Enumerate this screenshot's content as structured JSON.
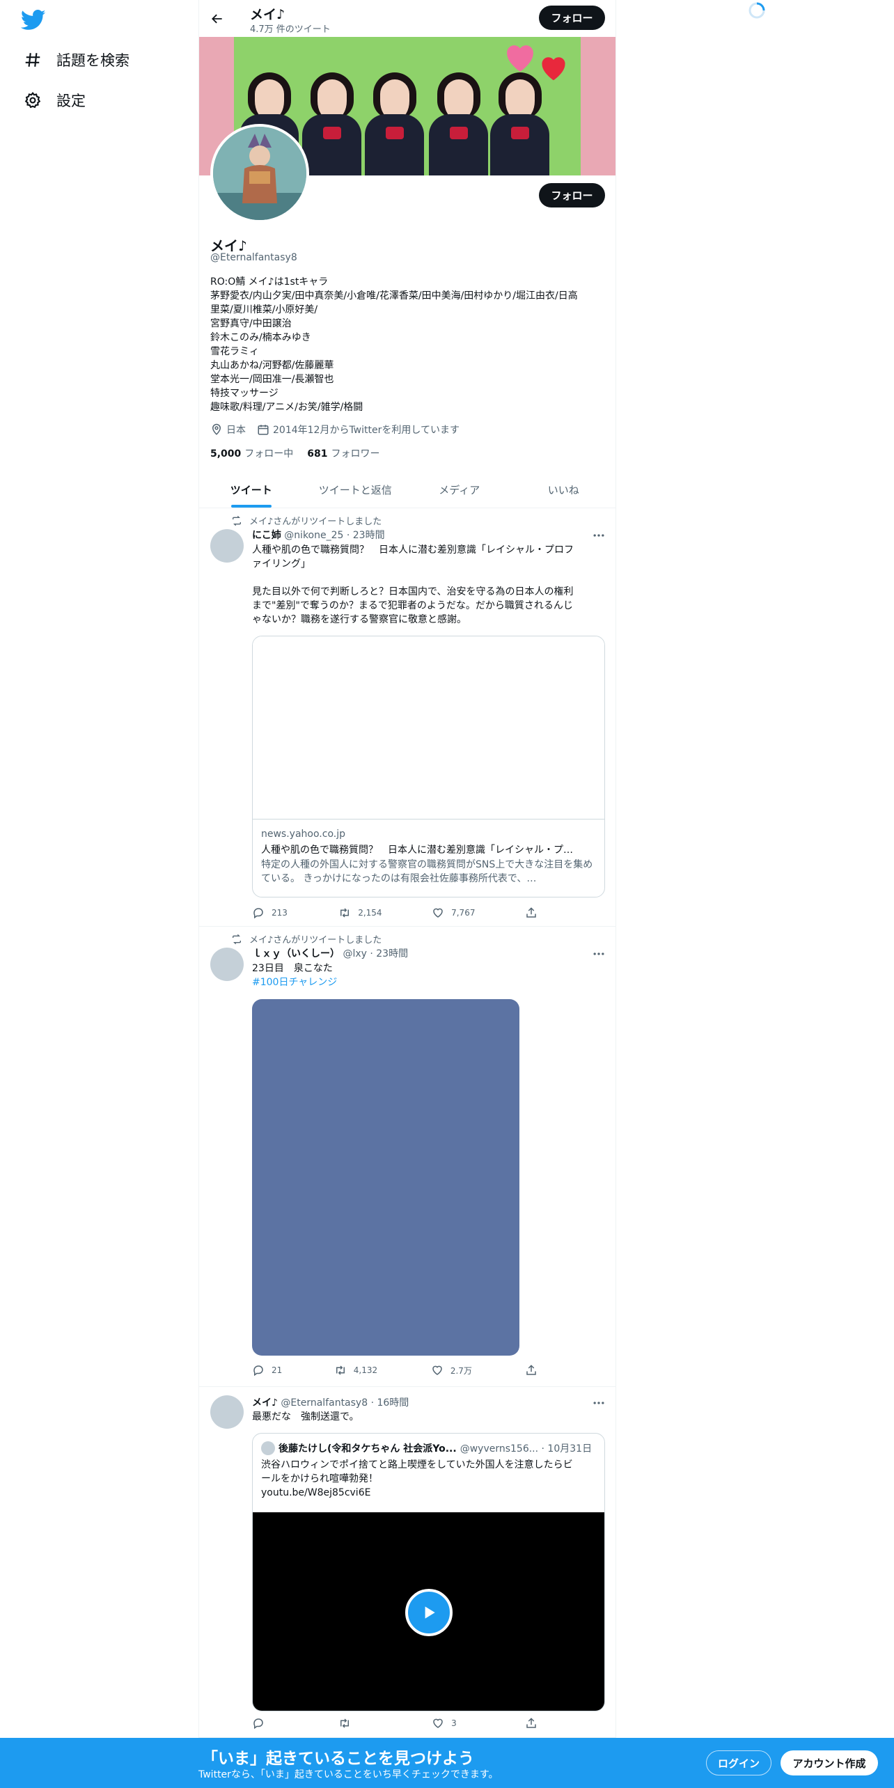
{
  "nav": {
    "explore_label": "話題を検索",
    "settings_label": "設定"
  },
  "header": {
    "title": "メイ♪",
    "subtitle": "4.7万 件のツイート",
    "follow_label": "フォロー"
  },
  "profile": {
    "name": "メイ♪",
    "handle": "@Eternalfantasy8",
    "follow_label": "フォロー",
    "bio_lines": [
      "RO:O鯖 メイ♪は1stキャラ",
      "茅野愛衣/内山夕実/田中真奈美/小倉唯/花澤香菜/田中美海/田村ゆかり/堀江由衣/日高",
      "里菜/夏川椎菜/小原好美/",
      "宮野真守/中田譲治",
      "鈴木このみ/楠本みゆき",
      "雪花ラミィ",
      "丸山あかね/河野都/佐藤麗華",
      "堂本光一/岡田准一/長瀬智也",
      "特技マッサージ",
      "趣味歌/料理/アニメ/お笑/雑学/格闘"
    ],
    "location": "日本",
    "joined": "2014年12月からTwitterを利用しています",
    "following_count": "5,000",
    "following_label": "フォロー中",
    "followers_count": "681",
    "followers_label": "フォロワー"
  },
  "tabs": [
    "ツイート",
    "ツイートと返信",
    "メディア",
    "いいね"
  ],
  "tweets": [
    {
      "retweet_note": "メイ♪さんがリツイートしました",
      "name": "にこ姉",
      "meta": "@nikone_25 · 23時間",
      "text_lines": [
        "人種や肌の色で職務質問？　日本人に潜む差別意識「レイシャル・プロフ",
        "ァイリング」",
        "",
        "見た目以外で何で判断しろと？日本国内で、治安を守る為の日本人の権利",
        "まで\"差別\"で奪うのか？まるで犯罪者のようだな。だから職質されるんじ",
        "ゃないか？職務を遂行する警察官に敬意と感謝。"
      ],
      "card": {
        "domain": "news.yahoo.co.jp",
        "title": "人種や肌の色で職務質問？　日本人に潜む差別意識「レイシャル・プ…",
        "description": "特定の人種の外国人に対する警察官の職務質問がSNS上で大きな注目を集めている。 きっかけになったのは有限会社佐藤事務所代表で、…"
      },
      "replies": "213",
      "retweets": "2,154",
      "likes": "7,767"
    },
    {
      "retweet_note": "メイ♪さんがリツイートしました",
      "name": "ｌｘｙ（いくしー）",
      "meta": "@lxy · 23時間",
      "text": "23日目　泉こなた",
      "hashtag": "#100日チャレンジ",
      "media_color": "#5c73a3",
      "replies": "21",
      "retweets": "4,132",
      "likes": "2.7万"
    },
    {
      "name": "メイ♪",
      "meta": "@Eternalfantasy8 · 16時間",
      "text": "最悪だな　強制送還で。",
      "quote": {
        "name": "後藤たけし(令和タケちゃん 社会派Yo...",
        "meta": "@wyverns156... · 10月31日",
        "text_lines": [
          "渋谷ハロウィンでポイ捨てと路上喫煙をしていた外国人を注意したらビ",
          "ールをかけられ喧嘩勃発！",
          "youtu.be/W8ej85cvi6E"
        ]
      },
      "likes": "3"
    }
  ],
  "bottom_bar": {
    "title": "「いま」起きていることを見つけよう",
    "subtitle": "Twitterなら、「いま」起きていることをいち早くチェックできます。",
    "login_label": "ログイン",
    "signup_label": "アカウント作成"
  },
  "colors": {
    "accent": "#1d9bf0",
    "text": "#0f1419",
    "muted": "#536471"
  }
}
